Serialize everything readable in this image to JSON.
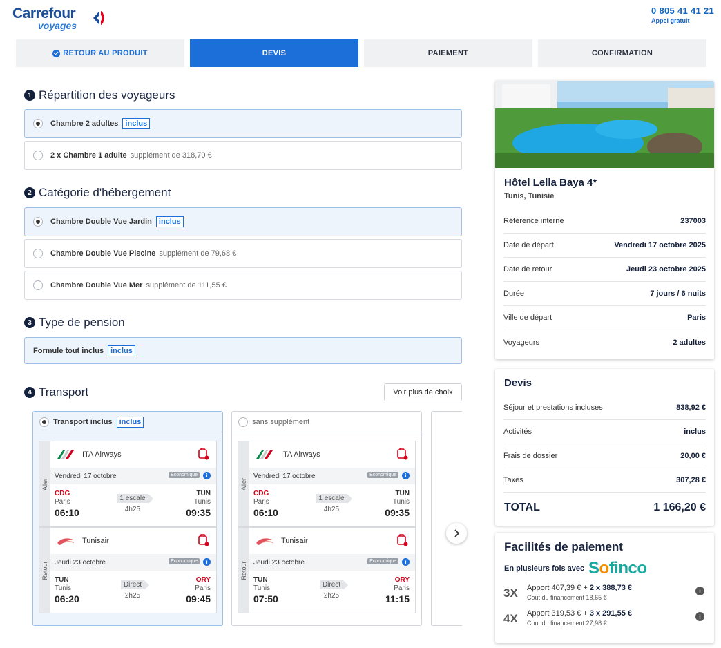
{
  "header": {
    "brand": "Carrefour",
    "brand_sub": "voyages",
    "phone": "0 805 41 41 21",
    "phone_note": "Appel gratuit"
  },
  "tabs": [
    {
      "label": "RETOUR AU PRODUIT"
    },
    {
      "label": "DEVIS"
    },
    {
      "label": "PAIEMENT"
    },
    {
      "label": "CONFIRMATION"
    }
  ],
  "sections": {
    "s1": {
      "num": "1",
      "title": "Répartition des voyageurs",
      "options": [
        {
          "name": "Chambre 2 adultes",
          "badge": "inclus"
        },
        {
          "name": "2 x Chambre 1 adulte",
          "supp": "supplément de 318,70 €"
        }
      ]
    },
    "s2": {
      "num": "2",
      "title": "Catégorie d'hébergement",
      "options": [
        {
          "name": "Chambre Double Vue Jardin",
          "badge": "inclus"
        },
        {
          "name": "Chambre Double Vue Piscine",
          "supp": "supplément de 79,68 €"
        },
        {
          "name": "Chambre Double Vue Mer",
          "supp": "supplément de 111,55 €"
        }
      ]
    },
    "s3": {
      "num": "3",
      "title": "Type de pension",
      "options": [
        {
          "name": "Formule tout inclus",
          "badge": "inclus"
        }
      ]
    },
    "s4": {
      "num": "4",
      "title": "Transport",
      "more": "Voir plus de choix"
    }
  },
  "transport": [
    {
      "title": "Transport inclus",
      "badge": "inclus",
      "aller": {
        "side": "Aller",
        "airline": "ITA Airways",
        "date": "Vendredi 17 octobre",
        "class": "Économique",
        "from_code": "CDG",
        "from_city": "Paris",
        "from_time": "06:10",
        "stops": "1 escale",
        "duration": "4h25",
        "to_code": "TUN",
        "to_city": "Tunis",
        "to_time": "09:35"
      },
      "retour": {
        "side": "Retour",
        "airline": "Tunisair",
        "date": "Jeudi 23 octobre",
        "class": "Économique",
        "from_code": "TUN",
        "from_city": "Tunis",
        "from_time": "06:20",
        "stops": "Direct",
        "duration": "2h25",
        "to_code": "ORY",
        "to_city": "Paris",
        "to_time": "09:45"
      }
    },
    {
      "title": "sans supplément",
      "aller": {
        "side": "Aller",
        "airline": "ITA Airways",
        "date": "Vendredi 17 octobre",
        "class": "Économique",
        "from_code": "CDG",
        "from_city": "Paris",
        "from_time": "06:10",
        "stops": "1 escale",
        "duration": "4h25",
        "to_code": "TUN",
        "to_city": "Tunis",
        "to_time": "09:35"
      },
      "retour": {
        "side": "Retour",
        "airline": "Tunisair",
        "date": "Jeudi 23 octobre",
        "class": "Économique",
        "from_code": "TUN",
        "from_city": "Tunis",
        "from_time": "07:50",
        "stops": "Direct",
        "duration": "2h25",
        "to_code": "ORY",
        "to_city": "Paris",
        "to_time": "11:15"
      }
    }
  ],
  "hotel": {
    "name": "Hôtel Lella Baya 4*",
    "location": "Tunis, Tunisie",
    "details": [
      {
        "k": "Référence interne",
        "v": "237003"
      },
      {
        "k": "Date de départ",
        "v": "Vendredi 17 octobre 2025"
      },
      {
        "k": "Date de retour",
        "v": "Jeudi 23 octobre 2025"
      },
      {
        "k": "Durée",
        "v": "7 jours / 6 nuits"
      },
      {
        "k": "Ville de départ",
        "v": "Paris"
      },
      {
        "k": "Voyageurs",
        "v": "2 adultes"
      }
    ]
  },
  "devis": {
    "title": "Devis",
    "rows": [
      {
        "k": "Séjour et prestations incluses",
        "v": "838,92 €"
      },
      {
        "k": "Activités",
        "v": "inclus"
      },
      {
        "k": "Frais de dossier",
        "v": "20,00 €"
      },
      {
        "k": "Taxes",
        "v": "307,28 €"
      }
    ],
    "total_label": "TOTAL",
    "total_value": "1 166,20 €"
  },
  "payment": {
    "title": "Facilités de paiement",
    "subtitle": "En plusieurs fois avec",
    "partner": "Sofinco",
    "plans": [
      {
        "x": "3X",
        "line_a": "Apport 407,39 € + ",
        "line_b": "2 x 388,73 €",
        "cost": "Cout du financement 18,65 €"
      },
      {
        "x": "4X",
        "line_a": "Apport 319,53 € + ",
        "line_b": "3 x 291,55 €",
        "cost": "Cout du financement 27,98 €"
      }
    ]
  }
}
